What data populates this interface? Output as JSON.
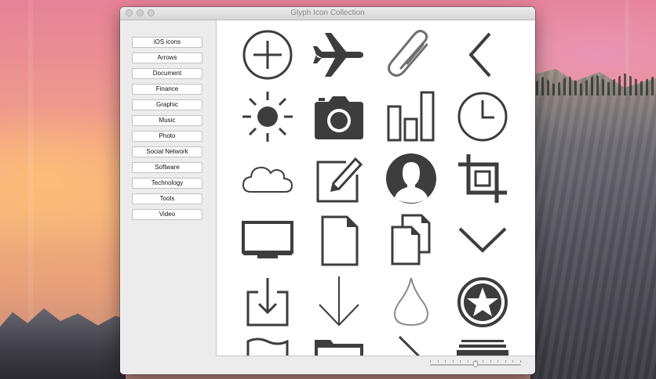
{
  "window": {
    "title": "Glyph Icon Collection"
  },
  "sidebar": {
    "categories": [
      {
        "label": "iOS icons"
      },
      {
        "label": "Arrows"
      },
      {
        "label": "Document"
      },
      {
        "label": "Finance"
      },
      {
        "label": "Graphic"
      },
      {
        "label": "Music"
      },
      {
        "label": "Photo"
      },
      {
        "label": "Social Network"
      },
      {
        "label": "Software"
      },
      {
        "label": "Technology"
      },
      {
        "label": "Tools"
      },
      {
        "label": "Video"
      }
    ]
  },
  "icon_grid": {
    "icon_color": "#3d3d3d",
    "outline_color": "#8a8a8a",
    "rows": [
      [
        "plus-circle-icon",
        "airplane-icon",
        "paperclip-icon",
        "chevron-left-icon"
      ],
      [
        "sun-icon",
        "camera-icon",
        "bar-chart-icon",
        "clock-icon"
      ],
      [
        "cloud-icon",
        "edit-icon",
        "user-avatar-icon",
        "crop-icon"
      ],
      [
        "monitor-icon",
        "document-icon",
        "documents-icon",
        "chevron-down-icon"
      ],
      [
        "download-tray-icon",
        "arrow-down-icon",
        "drop-icon",
        "star-badge-icon"
      ],
      [
        "flag-icon",
        "folder-icon",
        "line-icon",
        "stack-icon"
      ]
    ]
  },
  "zoom_slider": {
    "value": 0.5,
    "tick_count": 13
  }
}
